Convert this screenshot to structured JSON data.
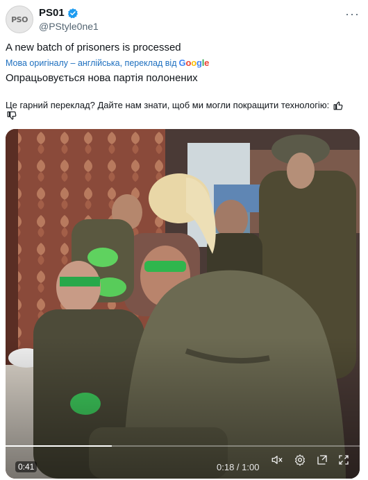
{
  "author": {
    "avatar_text": "PSO",
    "display_name": "PS01",
    "handle": "@PStyle0ne1"
  },
  "tweet": {
    "text": "A new batch of prisoners is processed",
    "translation_note": "Мова оригіналу – англійська, переклад від",
    "translation_provider": "Google",
    "translated_text": "Опрацьовується нова партія полонених"
  },
  "feedback": {
    "question": "Це гарний переклад? Дайте нам знати, щоб ми могли покращити технологію:"
  },
  "video": {
    "elapsed_badge": "0:41",
    "time_readout": "0:18 / 1:00",
    "progress": 0.3
  },
  "colors": {
    "verified": "#1d9bf0",
    "link": "#1d6fbf"
  },
  "icons": [
    "more-icon",
    "verified-badge-icon",
    "thumbs-up-icon",
    "thumbs-down-icon",
    "mute-icon",
    "settings-icon",
    "popout-icon",
    "fullscreen-icon"
  ]
}
